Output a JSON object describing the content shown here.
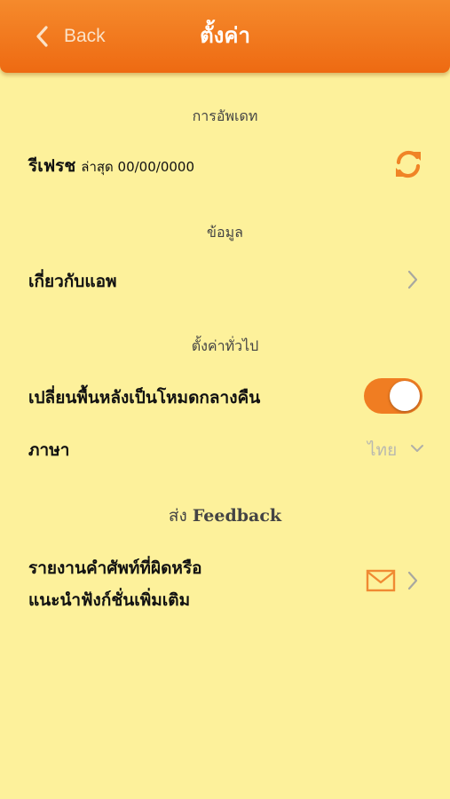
{
  "header": {
    "back_label": "Back",
    "title": "ตั้งค่า",
    "color": "#ef6f16"
  },
  "sections": {
    "update": {
      "title": "การอัพเดท",
      "refresh_label": "รีเฟรช",
      "refresh_sub": "ล่าสุด 00/00/0000",
      "icon": "refresh-icon"
    },
    "info": {
      "title": "ข้อมูล",
      "about_label": "เกี่ยวกับแอพ",
      "icon": "chevron-right-icon"
    },
    "general": {
      "title": "ตั้งค่าทั่วไป",
      "dark_mode_label": "เปลี่ยนพื้นหลังเป็นโหมดกลางคืน",
      "dark_mode_enabled": true,
      "language_label": "ภาษา",
      "language_value": "ไทย"
    },
    "feedback": {
      "title_prefix": "ส่ง",
      "title_word": "Feedback",
      "report_line1": "รายงานคำศัพท์ที่ผิดหรือ",
      "report_line2": "แนะนำฟังก์ชั่นเพิ่มเติม",
      "icons": [
        "mail-icon",
        "chevron-right-icon"
      ]
    }
  },
  "colors": {
    "background": "#fdf19b",
    "accent": "#f07d22",
    "chevron": "#a8a8a0",
    "mail": "#f08a33"
  }
}
